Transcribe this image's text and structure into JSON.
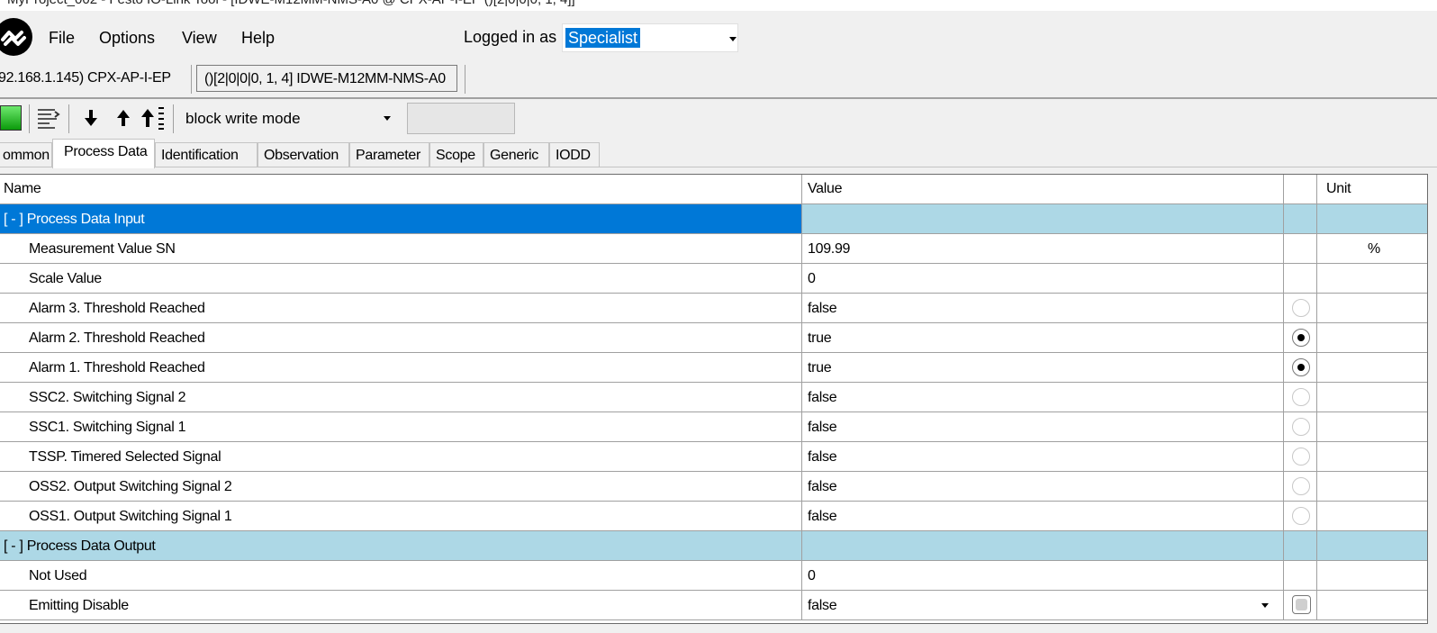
{
  "window": {
    "title": "MyProject_002 - Festo IO-Link Tool - [IDWE-M12MM-NMS-A0 @ CPX-AP-I-EP ()[2|0|0|0, 1, 4]]"
  },
  "menubar": {
    "items": [
      "File",
      "Options",
      "View",
      "Help"
    ],
    "login_label": "Logged in as",
    "login_value": "Specialist"
  },
  "device": {
    "controller_label": "92.168.1.145) CPX-AP-I-EP",
    "device_tab_label": "()[2|0|0|0, 1, 4] IDWE-M12MM-NMS-A0"
  },
  "toolbar": {
    "status_color": "#1ec31e",
    "icons": [
      "status-light-icon",
      "list-edit-icon",
      "read-arrow-down-icon",
      "write-arrow-up-icon",
      "write-all-icon"
    ],
    "mode_value": "block write mode"
  },
  "tabs": [
    "ommon",
    "Process Data",
    "Identification",
    "Observation",
    "Parameter",
    "Scope",
    "Generic",
    "IODD"
  ],
  "active_tab": "Process Data",
  "table": {
    "headers": {
      "name": "Name",
      "value": "Value",
      "flag": "",
      "unit": "Unit"
    },
    "groups": {
      "input": "[ - ]  Process Data Input",
      "output": "[ - ]  Process Data Output"
    },
    "input_rows": [
      {
        "name": "Measurement Value SN",
        "value": "109.99",
        "unit": "%",
        "indicator": "none"
      },
      {
        "name": "Scale Value",
        "value": "0",
        "unit": "",
        "indicator": "none"
      },
      {
        "name": "Alarm 3. Threshold Reached",
        "value": "false",
        "unit": "",
        "indicator": "radio-off"
      },
      {
        "name": "Alarm 2. Threshold Reached",
        "value": "true",
        "unit": "",
        "indicator": "radio-on"
      },
      {
        "name": "Alarm 1. Threshold Reached",
        "value": "true",
        "unit": "",
        "indicator": "radio-on"
      },
      {
        "name": "SSC2. Switching Signal 2",
        "value": "false",
        "unit": "",
        "indicator": "radio-off"
      },
      {
        "name": "SSC1. Switching Signal 1",
        "value": "false",
        "unit": "",
        "indicator": "radio-off"
      },
      {
        "name": "TSSP. Timered Selected Signal",
        "value": "false",
        "unit": "",
        "indicator": "radio-off"
      },
      {
        "name": "OSS2. Output Switching Signal 2",
        "value": "false",
        "unit": "",
        "indicator": "radio-off"
      },
      {
        "name": "OSS1. Output Switching Signal 1",
        "value": "false",
        "unit": "",
        "indicator": "radio-off"
      }
    ],
    "output_rows": [
      {
        "name": "Not Used",
        "value": "0",
        "unit": "",
        "indicator": "none"
      },
      {
        "name": "Emitting Disable",
        "value": "false",
        "unit": "",
        "indicator": "checkbox",
        "dropdown": true
      }
    ],
    "colors": {
      "group_bg": "#add8e6",
      "selected_bg": "#0078d7"
    }
  }
}
